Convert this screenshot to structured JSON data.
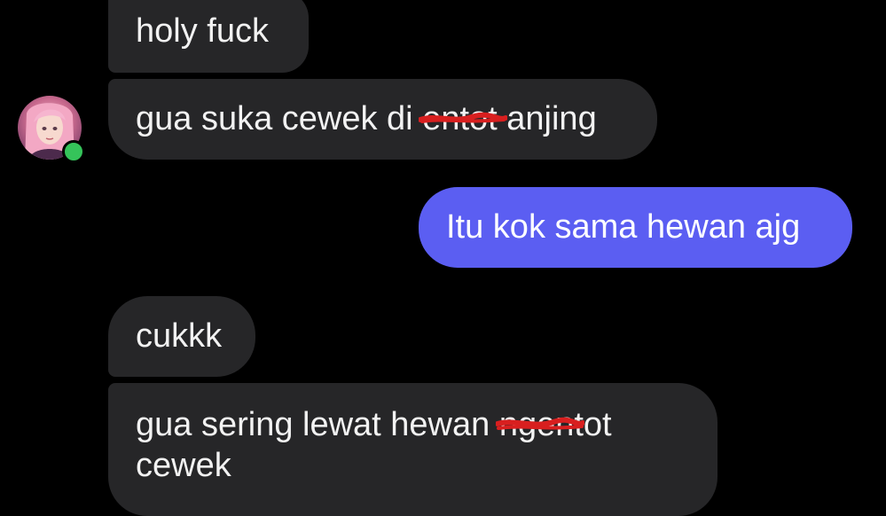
{
  "conversation": {
    "messages": [
      {
        "direction": "incoming",
        "text": "holy fuck"
      },
      {
        "direction": "incoming",
        "text_before": "gua suka cewek di ",
        "redacted": "entot",
        "text_after": " anjing"
      },
      {
        "direction": "outgoing",
        "text": "Itu kok sama hewan ajg"
      },
      {
        "direction": "incoming",
        "text": "cukkk"
      },
      {
        "direction": "incoming",
        "text_before": "gua sering lewat hewan ",
        "redacted": "ngentot",
        "text_after": "cewek"
      }
    ],
    "contact": {
      "avatar_icon": "profile-avatar-anime-girl",
      "status": "online"
    }
  },
  "colors": {
    "background": "#000000",
    "incoming_bubble": "#262628",
    "outgoing_bubble": "#5b5ef2",
    "online_indicator": "#35c35a",
    "scribble": "#d81f1f"
  }
}
